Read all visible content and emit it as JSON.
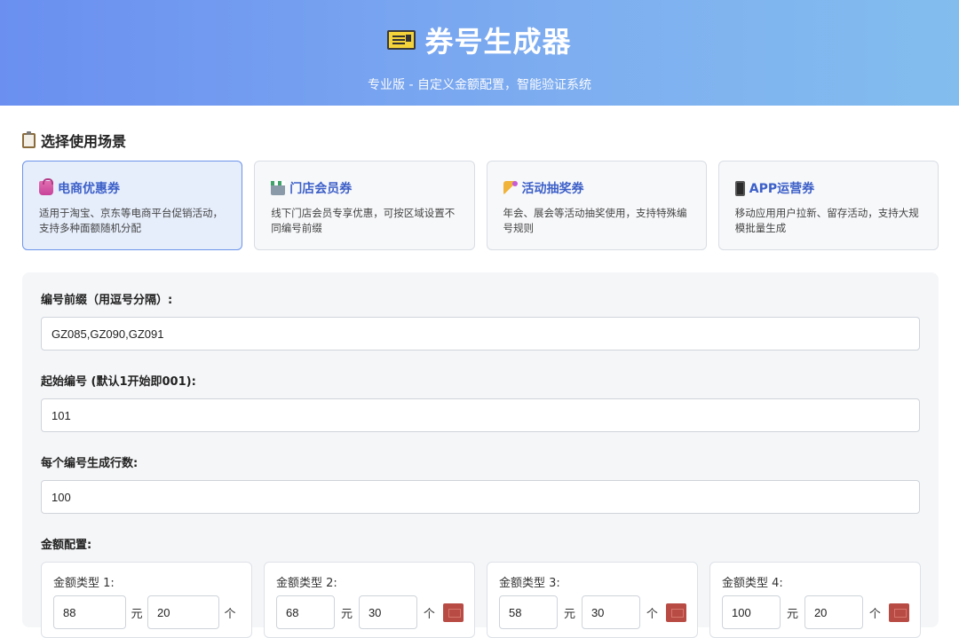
{
  "header": {
    "title": "券号生成器",
    "subtitle": "专业版 - 自定义金额配置，智能验证系统"
  },
  "scene_section": {
    "title": "选择使用场景"
  },
  "scenes": [
    {
      "title": "电商优惠券",
      "desc": "适用于淘宝、京东等电商平台促销活动，支持多种面额随机分配",
      "icon": "shopping-bag-icon",
      "active": true
    },
    {
      "title": "门店会员券",
      "desc": "线下门店会员专享优惠，可按区域设置不同编号前缀",
      "icon": "store-icon",
      "active": false
    },
    {
      "title": "活动抽奖券",
      "desc": "年会、展会等活动抽奖使用，支持特殊编号规则",
      "icon": "party-popper-icon",
      "active": false
    },
    {
      "title": "APP运营券",
      "desc": "移动应用用户拉新、留存活动，支持大规模批量生成",
      "icon": "mobile-phone-icon",
      "active": false
    }
  ],
  "form": {
    "prefix_label": "编号前缀（用逗号分隔）:",
    "prefix_value": "GZ085,GZ090,GZ091",
    "start_label": "起始编号 (默认1开始即001):",
    "start_value": "101",
    "rows_label": "每个编号生成行数:",
    "rows_value": "100",
    "amount_label": "金额配置:"
  },
  "amounts": [
    {
      "label": "金额类型 1:",
      "value": "88",
      "unit": "元",
      "count": "20",
      "count_unit": "个",
      "deletable": false
    },
    {
      "label": "金额类型 2:",
      "value": "68",
      "unit": "元",
      "count": "30",
      "count_unit": "个",
      "deletable": true
    },
    {
      "label": "金额类型 3:",
      "value": "58",
      "unit": "元",
      "count": "30",
      "count_unit": "个",
      "deletable": true
    },
    {
      "label": "金额类型 4:",
      "value": "100",
      "unit": "元",
      "count": "20",
      "count_unit": "个",
      "deletable": true
    }
  ],
  "colors": {
    "header_start": "#6a8ff0",
    "header_end": "#82bdee",
    "accent": "#3c5fc8",
    "delete": "#b84b43"
  }
}
